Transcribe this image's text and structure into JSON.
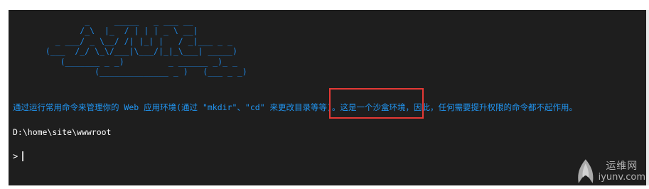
{
  "console": {
    "ascii_art": [
      "          _     _____   _ ___ __",
      "         /_\\  |_  / | | | _ \\ __|",
      "    _ ___/ _ \\__/ /| |_| |   / _|___ _ _",
      "  (___  /_/ \\_\\/___|\\___/|_|_\\___| _____)",
      "     (_______ _ _)         _ ______ _)_ _",
      "            (______________ _ )   (___ _ _)"
    ],
    "message": "通过运行常用命令来管理你的 Web 应用环境(通过 \"mkdir\"、\"cd\" 来更改目录等等)。这是一个沙盒环境，因此，任何需要提升权限的命令都不起作用。",
    "path": "D:\\home\\site\\wwwroot",
    "prompt": ">"
  },
  "watermark": {
    "cn": "运维网",
    "en": "iyunv.com"
  },
  "colors": {
    "background": "#1e1e1e",
    "ascii": "#1e88e5",
    "message": "#2196f3",
    "highlight": "#e53935"
  }
}
